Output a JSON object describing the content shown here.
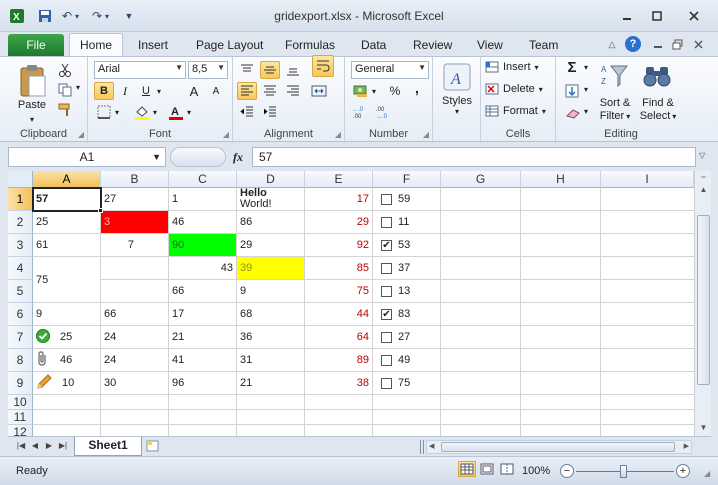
{
  "window": {
    "title": "gridexport.xlsx - Microsoft Excel"
  },
  "ribbon_tabs": {
    "file": "File",
    "home": "Home",
    "insert": "Insert",
    "page_layout": "Page Layout",
    "formulas": "Formulas",
    "data": "Data",
    "review": "Review",
    "view": "View",
    "team": "Team"
  },
  "clipboard": {
    "paste": "Paste",
    "label": "Clipboard"
  },
  "font": {
    "name": "Arial",
    "size": "8,5",
    "label": "Font",
    "bold": "B",
    "italic": "I",
    "underline": "U",
    "grow": "A",
    "shrink": "A"
  },
  "alignment": {
    "label": "Alignment"
  },
  "number": {
    "format": "General",
    "label": "Number",
    "percent": "%",
    "comma": ","
  },
  "styles": {
    "label": "Styles"
  },
  "cells": {
    "insert": "Insert",
    "delete": "Delete",
    "format": "Format",
    "label": "Cells"
  },
  "editing": {
    "sigma": "Σ",
    "sort_filter_1": "Sort &",
    "sort_filter_2": "Filter",
    "find_select_1": "Find &",
    "find_select_2": "Select",
    "label": "Editing"
  },
  "formula_bar": {
    "name_box": "A1",
    "fx": "fx",
    "value": "57"
  },
  "grid": {
    "columns": [
      "A",
      "B",
      "C",
      "D",
      "E",
      "F",
      "G",
      "H",
      "I"
    ],
    "rows": [
      "1",
      "2",
      "3",
      "4",
      "5",
      "6",
      "7",
      "8",
      "9",
      "10",
      "11",
      "12"
    ],
    "cells": {
      "a1": "57",
      "b1": "27",
      "c1": "1",
      "d1_line1": "Hello",
      "d1_line2": "World!",
      "e1": "17",
      "f1": "59",
      "a2": "25",
      "b2": "3",
      "c2": "46",
      "d2": "86",
      "e2": "29",
      "f2": "11",
      "a3": "61",
      "b3": "7",
      "c3": "90",
      "d3": "29",
      "e3": "92",
      "f3": "53",
      "a4": "75",
      "c4": "43",
      "d4": "39",
      "e4": "85",
      "f4": "37",
      "c5": "66",
      "d5": "9",
      "e5": "75",
      "f5": "13",
      "a6": "9",
      "b6": "66",
      "c6": "17",
      "d6": "68",
      "e6": "44",
      "f6": "83",
      "a7": "25",
      "b7": "24",
      "c7": "21",
      "d7": "36",
      "e7": "64",
      "f7": "27",
      "a8": "46",
      "b8": "24",
      "c8": "41",
      "d8": "31",
      "e8": "89",
      "f8": "49",
      "a9": "10",
      "b9": "30",
      "c9": "96",
      "d9": "21",
      "e9": "38",
      "f9": "75"
    },
    "checked": {
      "f1": false,
      "f2": false,
      "f3": true,
      "f4": false,
      "f5": false,
      "f6": true,
      "f7": false,
      "f8": false,
      "f9": false
    },
    "fill_colors": {
      "b2": "#ff0000",
      "c3": "#00ff00",
      "d4": "#ffff00"
    }
  },
  "sheets": {
    "active": "Sheet1"
  },
  "status_bar": {
    "mode": "Ready",
    "zoom": "100%"
  }
}
